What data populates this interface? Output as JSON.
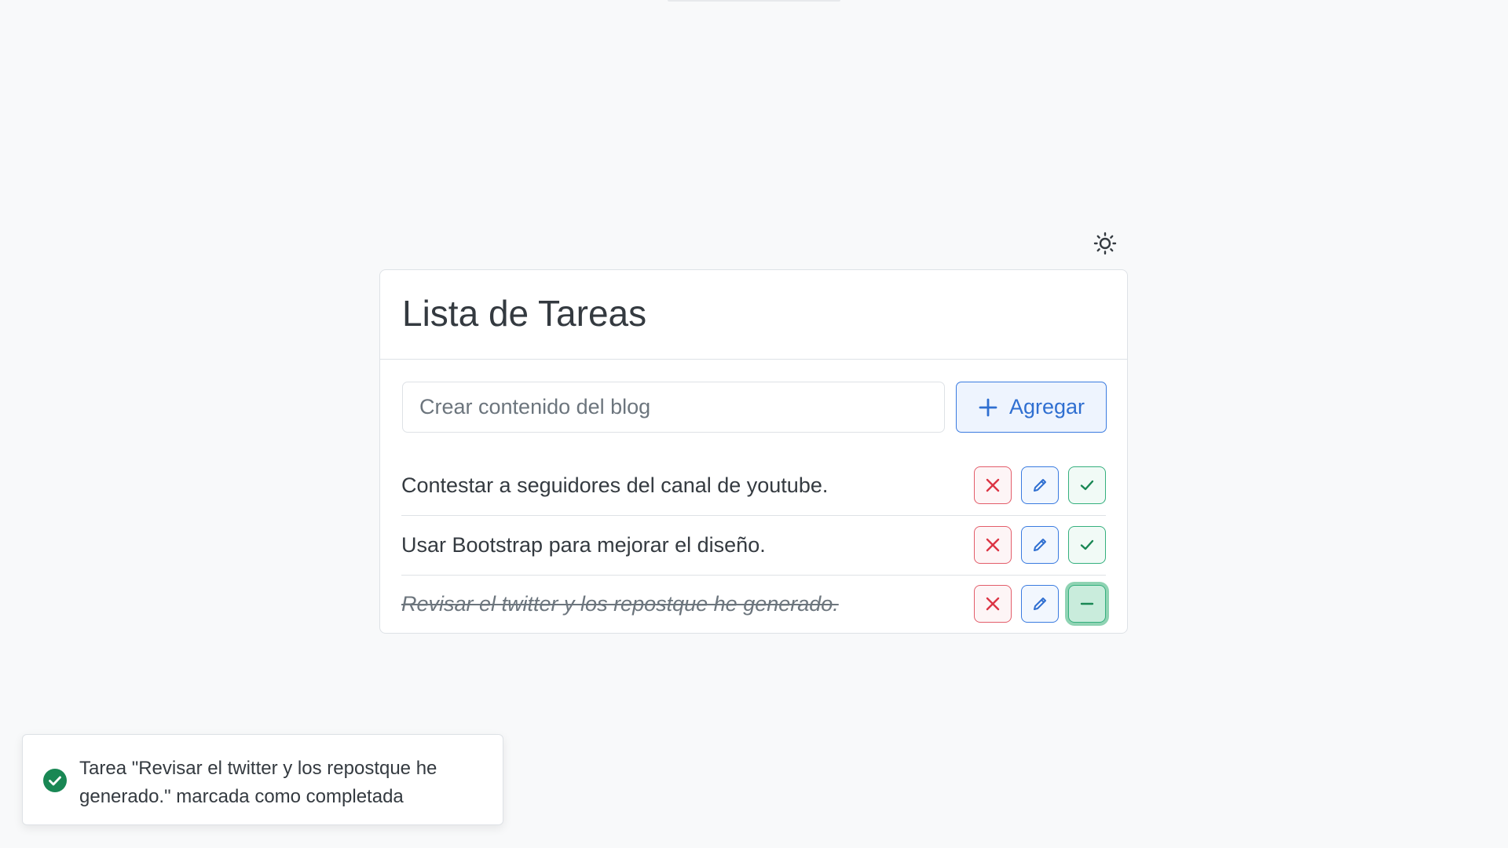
{
  "header": {
    "title": "Lista de Tareas"
  },
  "theme_toggle": {
    "icon": "sun-icon"
  },
  "add_task": {
    "placeholder": "Crear contenido del blog",
    "value": "",
    "button_label": "Agregar",
    "button_icon": "plus-icon"
  },
  "tasks": [
    {
      "text": "Contestar a seguidores del canal de youtube.",
      "completed": false
    },
    {
      "text": "Usar Bootstrap para mejorar el diseño.",
      "completed": false
    },
    {
      "text": "Revisar el twitter y los repostque he generado.",
      "completed": true
    }
  ],
  "toast": {
    "status": "success",
    "icon": "check-circle-icon",
    "message": "Tarea \"Revisar el twitter y los repostque he generado.\" marcada como completada"
  },
  "colors": {
    "background": "#f8f9fa",
    "danger": "#dc3545",
    "primary": "#0d6efd",
    "success": "#198754"
  }
}
